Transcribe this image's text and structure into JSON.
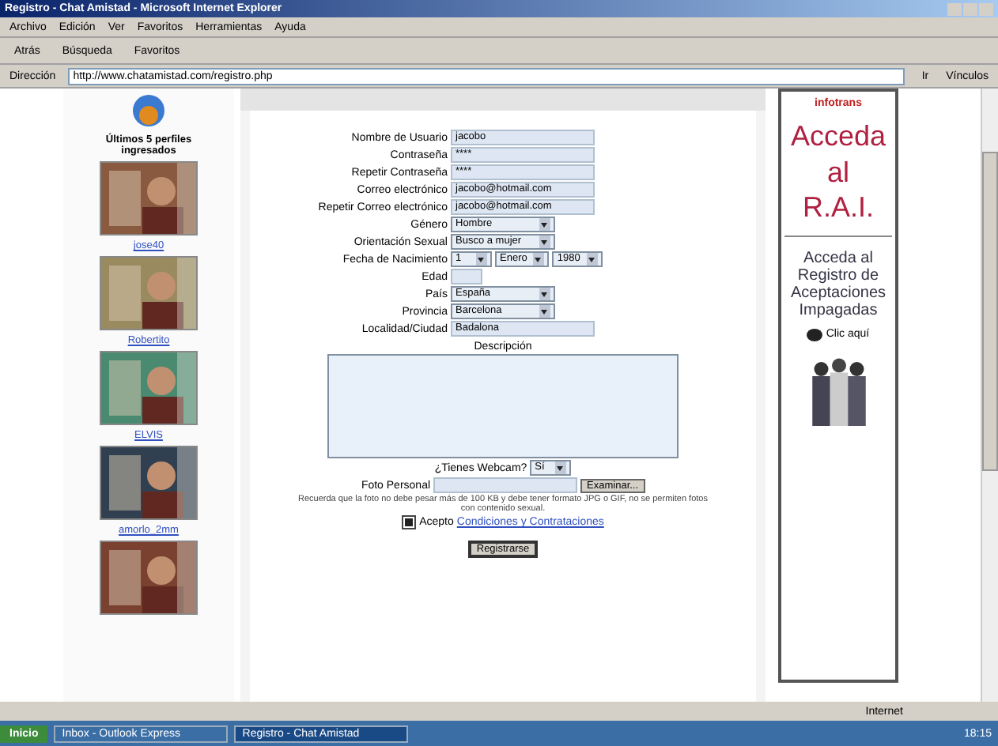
{
  "window": {
    "title": "Registro - Chat Amistad - Microsoft Internet Explorer"
  },
  "menu": [
    "Archivo",
    "Edición",
    "Ver",
    "Favoritos",
    "Herramientas",
    "Ayuda"
  ],
  "toolbar": [
    "Atrás",
    "Búsqueda",
    "Favoritos"
  ],
  "address": {
    "label": "Dirección",
    "value": "http://www.chatamistad.com/registro.php",
    "go": "Ir",
    "links": "Vínculos"
  },
  "sidebar": {
    "title": "Últimos 5 perfiles ingresados",
    "profiles": [
      {
        "name": "jose40",
        "kind": "picture"
      },
      {
        "name": "Robertito",
        "kind": "picture"
      },
      {
        "name": "ELVIS",
        "kind": "picture"
      },
      {
        "name": "amorlo_2mm",
        "kind": "picture"
      },
      {
        "kind": "picture"
      }
    ]
  },
  "form": {
    "fields": [
      {
        "kind": "text",
        "label": "Nombre de Usuario",
        "value": "jacobo"
      },
      {
        "kind": "text",
        "label": "Contraseña",
        "value": "****"
      },
      {
        "kind": "text",
        "label": "Repetir Contraseña",
        "value": "****"
      },
      {
        "kind": "text",
        "label": "Correo electrónico",
        "value": "jacobo@hotmail.com"
      },
      {
        "kind": "text",
        "label": "Repetir Correo electrónico",
        "value": "jacobo@hotmail.com"
      },
      {
        "kind": "select",
        "label": "Género",
        "value": "Hombre"
      },
      {
        "kind": "select",
        "label": "Orientación Sexual",
        "value": "Busco a mujer"
      },
      {
        "kind": "date",
        "label": "Fecha de Nacimiento",
        "parts": [
          "1",
          "Enero",
          "1980"
        ]
      },
      {
        "kind": "text",
        "label": "Edad"
      },
      {
        "kind": "select",
        "label": "País",
        "value": "España"
      },
      {
        "kind": "select",
        "label": "Provincia",
        "value": "Barcelona"
      },
      {
        "kind": "text",
        "label": "Localidad/Ciudad",
        "value": "Badalona"
      }
    ],
    "description_label": "Descripción",
    "webcam": {
      "label": "¿Tienes Webcam?",
      "value": "Sí"
    },
    "photo": {
      "label": "Foto Personal",
      "button": "Examinar..."
    },
    "notice": "Recuerda que la foto no debe pesar más de 100 KB y debe tener formato JPG o GIF, no se permiten fotos con contenido sexual.",
    "accept": {
      "checked": true,
      "text": "Acepto",
      "link": "Condiciones y Contrataciones"
    },
    "submit": "Registrarse"
  },
  "ad": {
    "logo": "infotrans",
    "tagline": "Acceda al R.A.I.",
    "body": "Acceda al Registro de Aceptaciones Impagadas",
    "link": "Clic aquí"
  },
  "taskbar": {
    "start": "Inicio",
    "tasks": [
      {
        "label": "Inbox - Outlook Express",
        "selected": false
      },
      {
        "label": "Registro - Chat Amistad",
        "selected": true
      }
    ],
    "clock": "18:15"
  },
  "status": "Internet"
}
